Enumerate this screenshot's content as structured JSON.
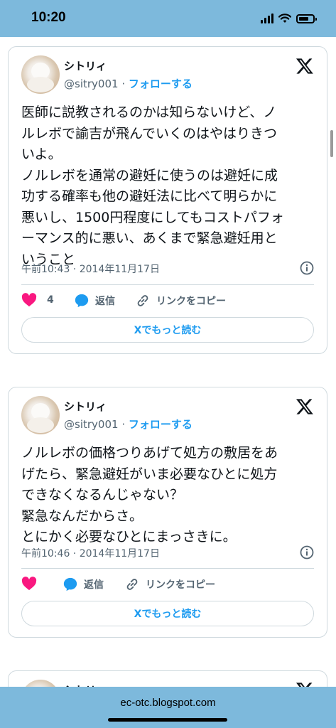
{
  "status_bar": {
    "time": "10:20"
  },
  "tweets": [
    {
      "name": "シトリィ",
      "handle": "@sitry001",
      "separator": "·",
      "follow_label": "フォローする",
      "text": "医師に説教されるのかは知らないけど、ノ\nルレボで諭吉が飛んでいくのはやはりきつ\nいよ。\nノルレボを通常の避妊に使うのは避妊に成\n功する確率も他の避妊法に比べて明らかに\n悪いし、1500円程度にしてもコストパフォ\nーマンス的に悪い、あくまで緊急避妊用と\nいうこと",
      "timestamp": "午前10:43 · 2014年11月17日",
      "like_count": "4",
      "reply_label": "返信",
      "copy_link_label": "リンクをコピー",
      "read_more_label": "Xでもっと読む"
    },
    {
      "name": "シトリィ",
      "handle": "@sitry001",
      "separator": "·",
      "follow_label": "フォローする",
      "text": "ノルレボの価格つりあげて処方の敷居をあ\nげたら、緊急避妊がいま必要なひとに処方\nできなくなるんじゃない？\n緊急なんだからさ。\nとにかく必要なひとにまっさきに。",
      "timestamp": "午前10:46 · 2014年11月17日",
      "like_count": "",
      "reply_label": "返信",
      "copy_link_label": "リンクをコピー",
      "read_more_label": "Xでもっと読む"
    },
    {
      "name": "シトリィ"
    }
  ],
  "bottom_bar": {
    "url": "ec-otc.blogspot.com"
  },
  "colors": {
    "bar_bg": "#7db9dc",
    "accent": "#1d9bf0",
    "like": "#f91880",
    "muted": "#536471"
  },
  "icons": [
    "x-logo-icon",
    "info-icon",
    "heart-icon",
    "reply-bubble-icon",
    "link-icon",
    "wifi-icon",
    "signal-icon",
    "battery-icon"
  ]
}
